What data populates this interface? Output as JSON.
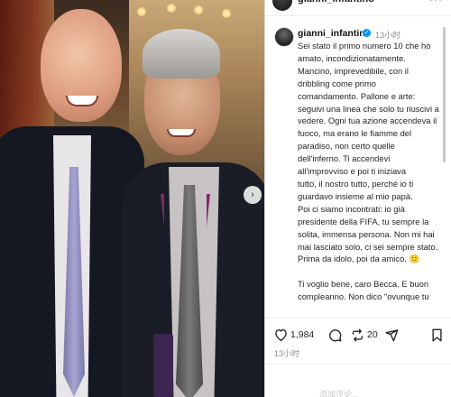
{
  "header": {
    "username": "gianni_infantino",
    "more_label": "···"
  },
  "post": {
    "username": "gianni_infantino",
    "verified_mark": "✓",
    "time": "13小时",
    "caption": "Sei stato il primo numero 10 che ho\namato, incondizionatamente.\nMancino, imprevedibile, con il\ndribbling come primo\ncomandamento. Pallone e arte:\nseguivi una linea che solo tu riuscivi a\nvedere. Ogni tua azione accendeva il\nfuoco, ma erano le fiamme del\nparadiso, non certo quelle\ndell'inferno. Ti accendevi\nall'improvviso e poi ti iniziava\ntutto, il nostro tutto, perché io ti\nguardavo insieme al mio papà.\nPoi ci siamo incontrati: io già\npresidente della FIFA, tu sempre la\nsolita, immensa persona. Non mi hai\nmai lasciato solo, ci sei sempre stato.\nPrima da idolo, poi da amico. 🙂\n\nTi voglio bene, caro Becca. E buon\ncompleanno. Non dico \"ovunque tu"
  },
  "actions": {
    "likes": "1,984",
    "reposts": "20",
    "date": "13小时"
  },
  "comment": {
    "placeholder": "添加评论..."
  },
  "photo": {
    "next_arrow": "›"
  }
}
